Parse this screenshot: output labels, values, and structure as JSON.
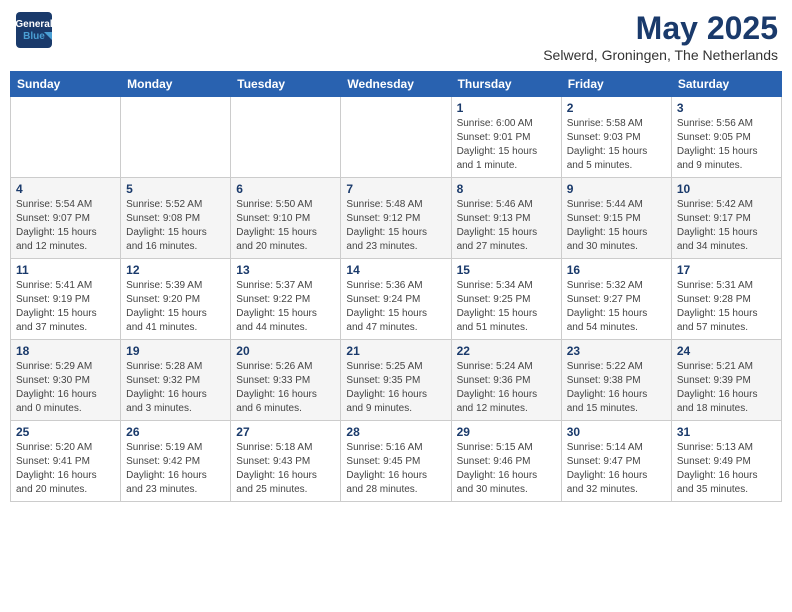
{
  "header": {
    "logo_line1": "General",
    "logo_line2": "Blue",
    "month": "May 2025",
    "location": "Selwerd, Groningen, The Netherlands"
  },
  "days_of_week": [
    "Sunday",
    "Monday",
    "Tuesday",
    "Wednesday",
    "Thursday",
    "Friday",
    "Saturday"
  ],
  "weeks": [
    [
      {
        "num": "",
        "info": ""
      },
      {
        "num": "",
        "info": ""
      },
      {
        "num": "",
        "info": ""
      },
      {
        "num": "",
        "info": ""
      },
      {
        "num": "1",
        "info": "Sunrise: 6:00 AM\nSunset: 9:01 PM\nDaylight: 15 hours\nand 1 minute."
      },
      {
        "num": "2",
        "info": "Sunrise: 5:58 AM\nSunset: 9:03 PM\nDaylight: 15 hours\nand 5 minutes."
      },
      {
        "num": "3",
        "info": "Sunrise: 5:56 AM\nSunset: 9:05 PM\nDaylight: 15 hours\nand 9 minutes."
      }
    ],
    [
      {
        "num": "4",
        "info": "Sunrise: 5:54 AM\nSunset: 9:07 PM\nDaylight: 15 hours\nand 12 minutes."
      },
      {
        "num": "5",
        "info": "Sunrise: 5:52 AM\nSunset: 9:08 PM\nDaylight: 15 hours\nand 16 minutes."
      },
      {
        "num": "6",
        "info": "Sunrise: 5:50 AM\nSunset: 9:10 PM\nDaylight: 15 hours\nand 20 minutes."
      },
      {
        "num": "7",
        "info": "Sunrise: 5:48 AM\nSunset: 9:12 PM\nDaylight: 15 hours\nand 23 minutes."
      },
      {
        "num": "8",
        "info": "Sunrise: 5:46 AM\nSunset: 9:13 PM\nDaylight: 15 hours\nand 27 minutes."
      },
      {
        "num": "9",
        "info": "Sunrise: 5:44 AM\nSunset: 9:15 PM\nDaylight: 15 hours\nand 30 minutes."
      },
      {
        "num": "10",
        "info": "Sunrise: 5:42 AM\nSunset: 9:17 PM\nDaylight: 15 hours\nand 34 minutes."
      }
    ],
    [
      {
        "num": "11",
        "info": "Sunrise: 5:41 AM\nSunset: 9:19 PM\nDaylight: 15 hours\nand 37 minutes."
      },
      {
        "num": "12",
        "info": "Sunrise: 5:39 AM\nSunset: 9:20 PM\nDaylight: 15 hours\nand 41 minutes."
      },
      {
        "num": "13",
        "info": "Sunrise: 5:37 AM\nSunset: 9:22 PM\nDaylight: 15 hours\nand 44 minutes."
      },
      {
        "num": "14",
        "info": "Sunrise: 5:36 AM\nSunset: 9:24 PM\nDaylight: 15 hours\nand 47 minutes."
      },
      {
        "num": "15",
        "info": "Sunrise: 5:34 AM\nSunset: 9:25 PM\nDaylight: 15 hours\nand 51 minutes."
      },
      {
        "num": "16",
        "info": "Sunrise: 5:32 AM\nSunset: 9:27 PM\nDaylight: 15 hours\nand 54 minutes."
      },
      {
        "num": "17",
        "info": "Sunrise: 5:31 AM\nSunset: 9:28 PM\nDaylight: 15 hours\nand 57 minutes."
      }
    ],
    [
      {
        "num": "18",
        "info": "Sunrise: 5:29 AM\nSunset: 9:30 PM\nDaylight: 16 hours\nand 0 minutes."
      },
      {
        "num": "19",
        "info": "Sunrise: 5:28 AM\nSunset: 9:32 PM\nDaylight: 16 hours\nand 3 minutes."
      },
      {
        "num": "20",
        "info": "Sunrise: 5:26 AM\nSunset: 9:33 PM\nDaylight: 16 hours\nand 6 minutes."
      },
      {
        "num": "21",
        "info": "Sunrise: 5:25 AM\nSunset: 9:35 PM\nDaylight: 16 hours\nand 9 minutes."
      },
      {
        "num": "22",
        "info": "Sunrise: 5:24 AM\nSunset: 9:36 PM\nDaylight: 16 hours\nand 12 minutes."
      },
      {
        "num": "23",
        "info": "Sunrise: 5:22 AM\nSunset: 9:38 PM\nDaylight: 16 hours\nand 15 minutes."
      },
      {
        "num": "24",
        "info": "Sunrise: 5:21 AM\nSunset: 9:39 PM\nDaylight: 16 hours\nand 18 minutes."
      }
    ],
    [
      {
        "num": "25",
        "info": "Sunrise: 5:20 AM\nSunset: 9:41 PM\nDaylight: 16 hours\nand 20 minutes."
      },
      {
        "num": "26",
        "info": "Sunrise: 5:19 AM\nSunset: 9:42 PM\nDaylight: 16 hours\nand 23 minutes."
      },
      {
        "num": "27",
        "info": "Sunrise: 5:18 AM\nSunset: 9:43 PM\nDaylight: 16 hours\nand 25 minutes."
      },
      {
        "num": "28",
        "info": "Sunrise: 5:16 AM\nSunset: 9:45 PM\nDaylight: 16 hours\nand 28 minutes."
      },
      {
        "num": "29",
        "info": "Sunrise: 5:15 AM\nSunset: 9:46 PM\nDaylight: 16 hours\nand 30 minutes."
      },
      {
        "num": "30",
        "info": "Sunrise: 5:14 AM\nSunset: 9:47 PM\nDaylight: 16 hours\nand 32 minutes."
      },
      {
        "num": "31",
        "info": "Sunrise: 5:13 AM\nSunset: 9:49 PM\nDaylight: 16 hours\nand 35 minutes."
      }
    ]
  ]
}
